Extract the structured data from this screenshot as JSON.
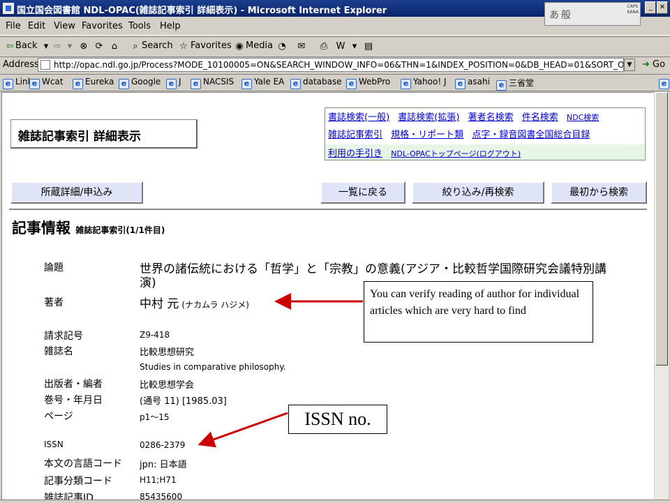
{
  "window": {
    "title": "国立国会図書館 NDL-OPAC(雑誌記事索引 詳細表示) - Microsoft Internet Explorer",
    "ime_text": "あ般",
    "ime_caps": "CAPS",
    "ime_kana": "KANA"
  },
  "menu": [
    "File",
    "Edit",
    "View",
    "Favorites",
    "Tools",
    "Help"
  ],
  "toolbar": {
    "back": "Back",
    "search": "Search",
    "favorites": "Favorites",
    "media": "Media"
  },
  "address": {
    "label": "Address",
    "url": "http://opac.ndl.go.jp/Process?MODE_10100005=ON&SEARCH_WINDOW_INFO=06&THN=1&INDEX_POSITION=0&DB_HEAD=01&SORT_OR",
    "go": "Go"
  },
  "links": {
    "label": "Links",
    "items": [
      "Wcat",
      "Eureka",
      "Google",
      "J",
      "NACSIS",
      "Yale EA",
      "database",
      "WebPro",
      "Yahoo! J",
      "asahi",
      "三省堂"
    ]
  },
  "page": {
    "title": "雑誌記事索引 詳細表示",
    "nav_row1": [
      "書誌検索(一般)",
      "書誌検索(拡張)",
      "著者名検索",
      "件名検索",
      "NDC検索"
    ],
    "nav_row2": [
      "雑誌記事索引",
      "規格・リポート類",
      "点字・録音図書全国総合目録"
    ],
    "nav_row3": [
      "利用の手引き",
      "NDL-OPACトップページ(ログアウト)"
    ],
    "buttons": {
      "holdings": "所蔵詳細/申込み",
      "back_to_list": "一覧に戻る",
      "refine": "絞り込み/再検索",
      "restart": "最初から検索"
    },
    "section_title": "記事情報",
    "section_sub": "雑誌記事索引(1/1件目)"
  },
  "record": {
    "title_label": "論題",
    "title_line1": "世界の諸伝統における「哲学」と「宗教」の意義(アジア・比較哲学国際研究会議特別講",
    "title_line2": "演)",
    "author_label": "著者",
    "author": "中村 元",
    "author_reading": "(ナカムラ ハジメ)",
    "call_label": "請求記号",
    "call_no": "Z9-418",
    "journal_label": "雑誌名",
    "journal": "比較思想研究",
    "journal_en": "Studies in comparative philosophy.",
    "publisher_label": "出版者・編者",
    "publisher": "比較思想学会",
    "volume_label": "巻号・年月日",
    "volume": "(通号 11) [1985.03]",
    "pages_label": "ページ",
    "pages": "p1～15",
    "issn_label": "ISSN",
    "issn": "0286-2379",
    "lang_label": "本文の言語コード",
    "lang": "jpn: 日本語",
    "class_label": "記事分類コード",
    "class_code": "H11;H71",
    "id_label": "雑誌記事ID",
    "id_value": "85435600"
  },
  "annotations": {
    "author_note": "You can verify reading of author for individual articles which are very hard to find",
    "issn_note": "ISSN no.",
    "arrow_color": "#cc0000"
  }
}
